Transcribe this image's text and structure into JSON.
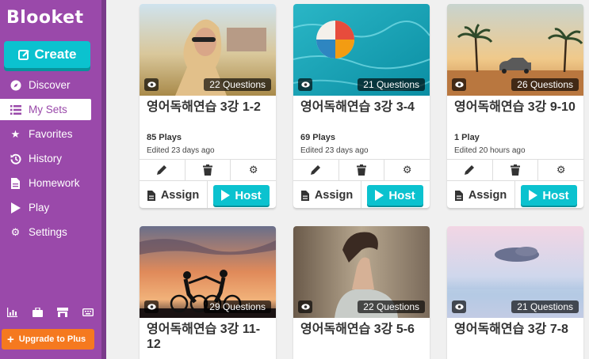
{
  "app": {
    "logo": "Blooket",
    "create_label": "Create",
    "upgrade_label": "Upgrade to Plus"
  },
  "nav": [
    {
      "label": "Discover",
      "icon": "compass-icon"
    },
    {
      "label": "My Sets",
      "icon": "list-icon",
      "active": true
    },
    {
      "label": "Favorites",
      "icon": "star-icon"
    },
    {
      "label": "History",
      "icon": "history-icon"
    },
    {
      "label": "Homework",
      "icon": "document-icon"
    },
    {
      "label": "Play",
      "icon": "play-icon"
    },
    {
      "label": "Settings",
      "icon": "gear-icon"
    }
  ],
  "bottom_icons": [
    "stats-icon",
    "briefcase-icon",
    "market-icon",
    "keyboard-icon"
  ],
  "card_actions": {
    "assign_label": "Assign",
    "host_label": "Host"
  },
  "sets": [
    {
      "questions": "22 Questions",
      "title": "영어독해연습 3강 1-2",
      "plays": "85 Plays",
      "edited": "Edited 23 days ago"
    },
    {
      "questions": "21 Questions",
      "title": "영어독해연습 3강 3-4",
      "plays": "69 Plays",
      "edited": "Edited 23 days ago"
    },
    {
      "questions": "26 Questions",
      "title": "영어독해연습 3강 9-10",
      "plays": "1 Play",
      "edited": "Edited 20 hours ago"
    },
    {
      "questions": "29 Questions",
      "title": "영어독해연습 3강 11-12"
    },
    {
      "questions": "22 Questions",
      "title": "영어독해연습 3강 5-6"
    },
    {
      "questions": "21 Questions",
      "title": "영어독해연습 3강 7-8"
    }
  ],
  "colors": {
    "sidebar": "#9a49aa",
    "accent": "#0bc2cf",
    "upgrade": "#f5791f"
  }
}
